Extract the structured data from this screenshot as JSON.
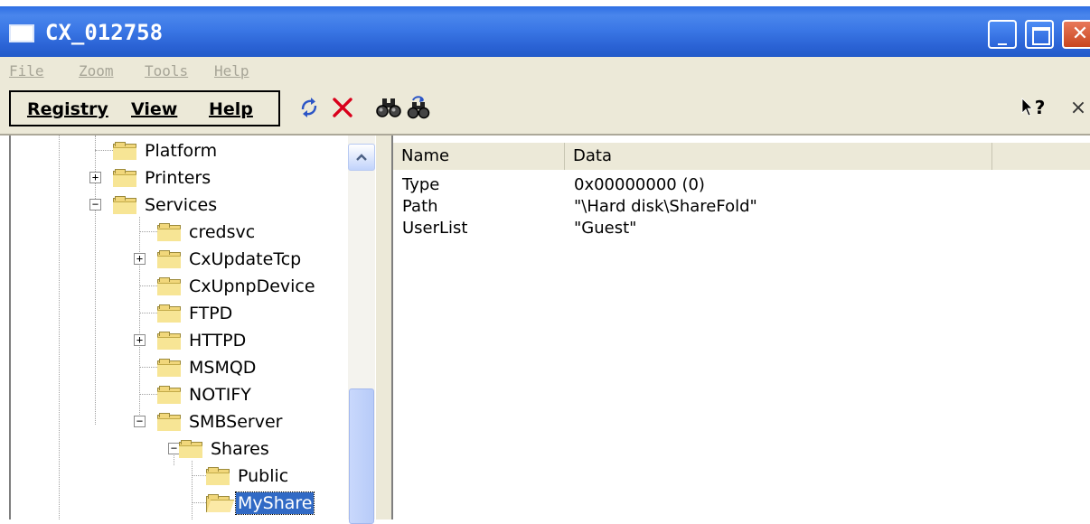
{
  "window": {
    "title": "CX_012758"
  },
  "menubar": [
    {
      "label": "File"
    },
    {
      "label": "Zoom"
    },
    {
      "label": "Tools"
    },
    {
      "label": "Help"
    }
  ],
  "toolbar": {
    "menus": [
      {
        "label": "Registry"
      },
      {
        "label": "View"
      },
      {
        "label": "Help"
      }
    ],
    "icons": [
      "refresh-icon",
      "delete-icon",
      "find-icon",
      "find-next-icon",
      "help-pointer-icon",
      "close-icon"
    ],
    "help_label": "?",
    "close_label": "×"
  },
  "tree": [
    {
      "label": "Platform"
    },
    {
      "label": "Printers"
    },
    {
      "label": "Services"
    },
    {
      "label": "credsvc"
    },
    {
      "label": "CxUpdateTcp"
    },
    {
      "label": "CxUpnpDevice"
    },
    {
      "label": "FTPD"
    },
    {
      "label": "HTTPD"
    },
    {
      "label": "MSMQD"
    },
    {
      "label": "NOTIFY"
    },
    {
      "label": "SMBServer"
    },
    {
      "label": "Shares"
    },
    {
      "label": "Public"
    },
    {
      "label": "MyShare"
    }
  ],
  "list": {
    "columns": [
      {
        "label": "Name"
      },
      {
        "label": "Data"
      },
      {
        "label": ""
      }
    ],
    "rows": [
      {
        "name": "Type",
        "data": "0x00000000 (0)"
      },
      {
        "name": "Path",
        "data": "\"\\Hard disk\\ShareFold\""
      },
      {
        "name": "UserList",
        "data": "\"Guest\""
      }
    ]
  },
  "colors": {
    "titlebar": "#2a62d4",
    "chrome": "#ece9d8",
    "selection": "#316ac5",
    "folder": "#f1d77b"
  }
}
